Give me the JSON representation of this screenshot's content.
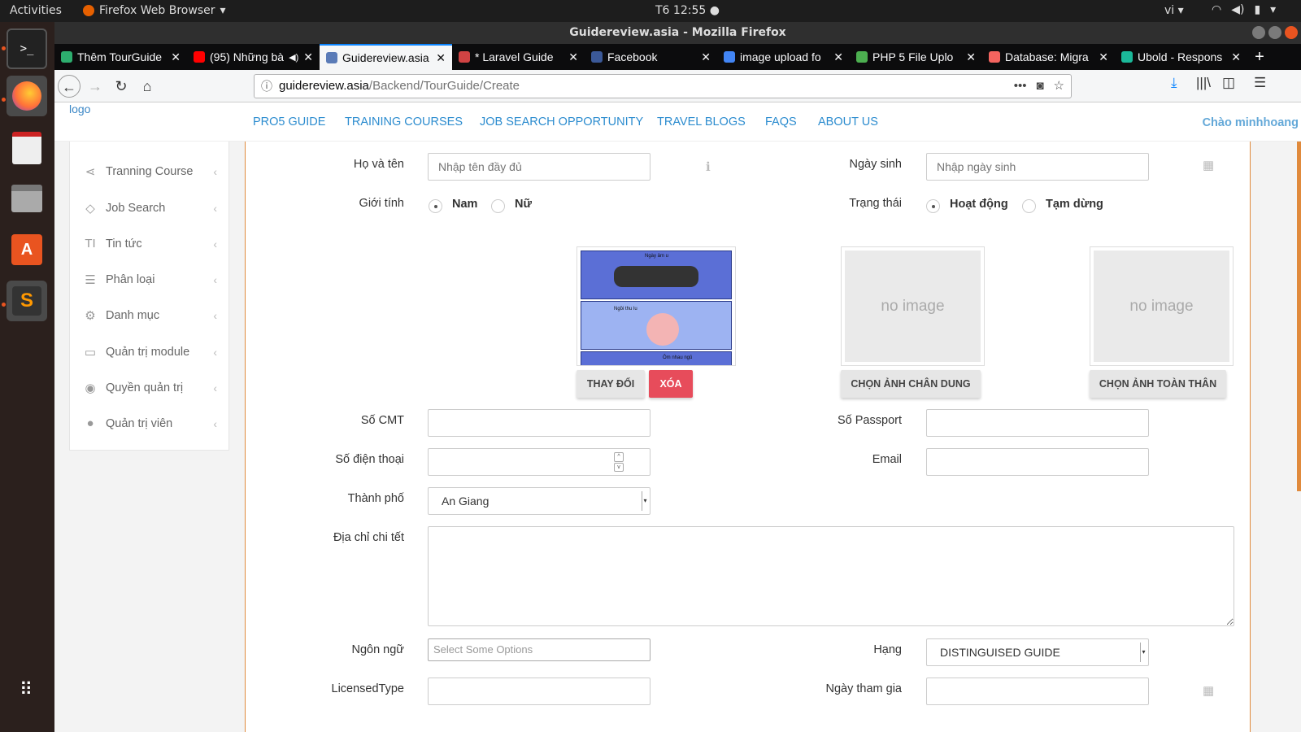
{
  "topbar": {
    "activities": "Activities",
    "app_name": "Firefox Web Browser",
    "clock": "T6 12:55 ●",
    "lang": "vi"
  },
  "window": {
    "title": "Guidereview.asia - Mozilla Firefox"
  },
  "tabs": [
    {
      "title": "Thêm TourGuide",
      "color": "#2dae6f"
    },
    {
      "title": "(95) Những bài",
      "color": "#ff0000",
      "audio": "◀)"
    },
    {
      "title": "Guidereview.asia",
      "color": "#5a7bb7"
    },
    {
      "title": "* Laravel Guide",
      "color": "#d04343"
    },
    {
      "title": "Facebook",
      "color": "#3b5998"
    },
    {
      "title": "image upload fo",
      "color": "#4285f4"
    },
    {
      "title": "PHP 5 File Uplo",
      "color": "#4caf50"
    },
    {
      "title": "Database: Migra",
      "color": "#f4645f"
    },
    {
      "title": "Ubold - Respons",
      "color": "#1bb99a"
    }
  ],
  "url": {
    "host": "guidereview.asia",
    "path": "/Backend/TourGuide/Create"
  },
  "site": {
    "logo": "logo",
    "menu": [
      "PRO5 GUIDE",
      "TRAINING COURSES",
      "JOB SEARCH OPPORTUNITY",
      "TRAVEL BLOGS",
      "FAQS",
      "ABOUT US"
    ],
    "greeting": "Chào minhhoang"
  },
  "sidebar": {
    "items": [
      {
        "label": "Tranning Course",
        "icon": "share-icon",
        "glyph": "⋖"
      },
      {
        "label": "Job Search",
        "icon": "diamond-icon",
        "glyph": "◇"
      },
      {
        "label": "Tin tức",
        "icon": "text-icon",
        "glyph": "TI"
      },
      {
        "label": "Phân loại",
        "icon": "list-icon",
        "glyph": "☰"
      },
      {
        "label": "Danh mục",
        "icon": "gear-icon",
        "glyph": "⚙"
      },
      {
        "label": "Quản trị module",
        "icon": "card-icon",
        "glyph": "▭"
      },
      {
        "label": "Quyền quản trị",
        "icon": "eye-icon",
        "glyph": "◉"
      },
      {
        "label": "Quản trị viên",
        "icon": "user-icon",
        "glyph": "●"
      }
    ],
    "chevron": "‹"
  },
  "form": {
    "fullname": {
      "label": "Họ và tên",
      "placeholder": "Nhập tên đầy đủ"
    },
    "birthday": {
      "label": "Ngày sinh",
      "placeholder": "Nhập ngày sinh"
    },
    "gender": {
      "label": "Giới tính",
      "options": [
        "Nam",
        "Nữ"
      ],
      "selected": "Nam"
    },
    "status": {
      "label": "Trạng thái",
      "options": [
        "Hoạt động",
        "Tạm dừng"
      ],
      "selected": "Hoạt động"
    },
    "photo_buttons": {
      "change": "THAY ĐỔI",
      "delete": "XÓA",
      "portrait": "CHỌN ẢNH CHÂN DUNG",
      "fullbody": "CHỌN ẢNH TOÀN THÂN"
    },
    "no_image": "no image",
    "comic": {
      "panel1": "Ngày âm u",
      "panel2": "Ngồi thu lu",
      "panel3": "Ôm nhau ngủ"
    },
    "id_card": {
      "label": "Số CMT",
      "value": ""
    },
    "passport": {
      "label": "Số Passport",
      "value": ""
    },
    "phone": {
      "label": "Số điện thoại",
      "value": ""
    },
    "email": {
      "label": "Email",
      "value": ""
    },
    "city": {
      "label": "Thành phố",
      "value": "An Giang"
    },
    "address": {
      "label": "Địa chỉ chi tết",
      "value": ""
    },
    "language": {
      "label": "Ngôn ngữ",
      "placeholder": "Select Some Options"
    },
    "rank": {
      "label": "Hạng",
      "value": "DISTINGUISED GUIDE"
    },
    "licensed": {
      "label": "LicensedType",
      "value": ""
    },
    "join_date": {
      "label": "Ngày tham gia",
      "value": ""
    }
  },
  "colors": {
    "accent_blue": "#2c8ccf",
    "danger": "#e74c5b",
    "orange_border": "#e08a3c"
  }
}
